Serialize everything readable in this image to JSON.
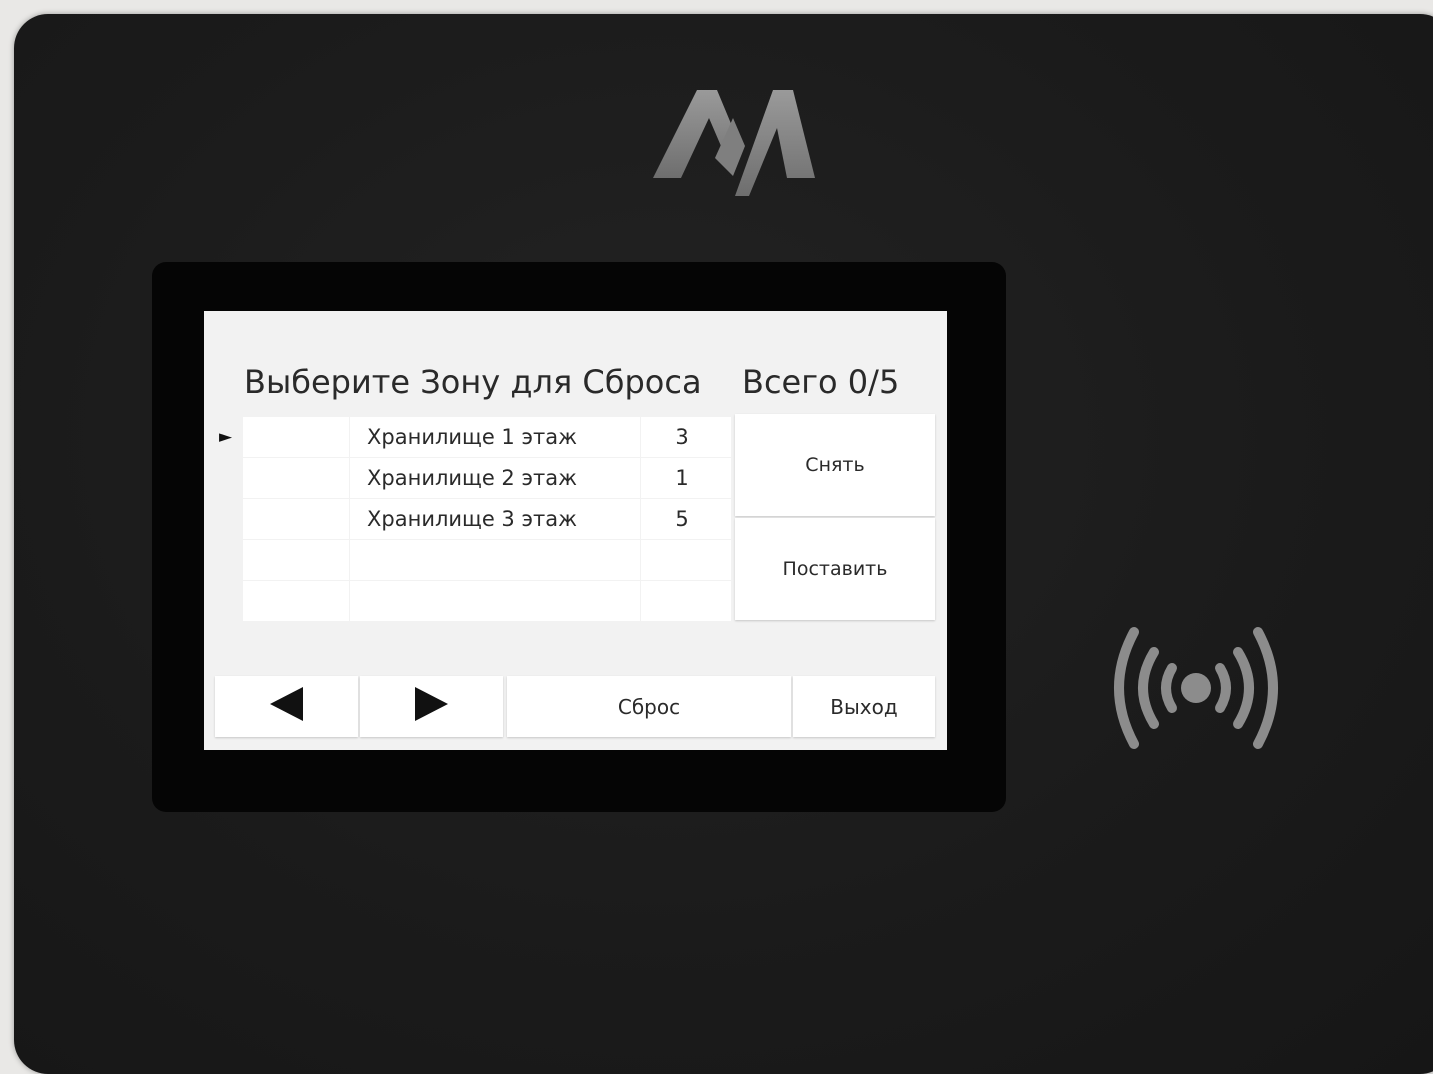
{
  "screen": {
    "title": "Выберите Зону для Сброса",
    "total_label": "Всего",
    "total_value": "0/5",
    "selected_marker": "►",
    "zones": [
      {
        "name": "Хранилище 1 этаж",
        "count": "3",
        "selected": true
      },
      {
        "name": "Хранилище 2 этаж",
        "count": "1",
        "selected": false
      },
      {
        "name": "Хранилище 3 этаж",
        "count": "5",
        "selected": false
      },
      {
        "name": "",
        "count": "",
        "selected": false
      },
      {
        "name": "",
        "count": "",
        "selected": false
      }
    ],
    "buttons": {
      "remove": "Снять",
      "set": "Поставить",
      "reset": "Сброс",
      "exit": "Выход"
    }
  },
  "icons": {
    "logo": "aa-logo",
    "prev": "arrow-left-icon",
    "next": "arrow-right-icon",
    "contactless": "contactless-icon"
  },
  "colors": {
    "device_body": "#1b1b1b",
    "bezel": "#050505",
    "screen_bg": "#f2f2f2",
    "cell_bg": "#ffffff",
    "logo": "#8a8a8a",
    "text": "#2a2a2a"
  }
}
